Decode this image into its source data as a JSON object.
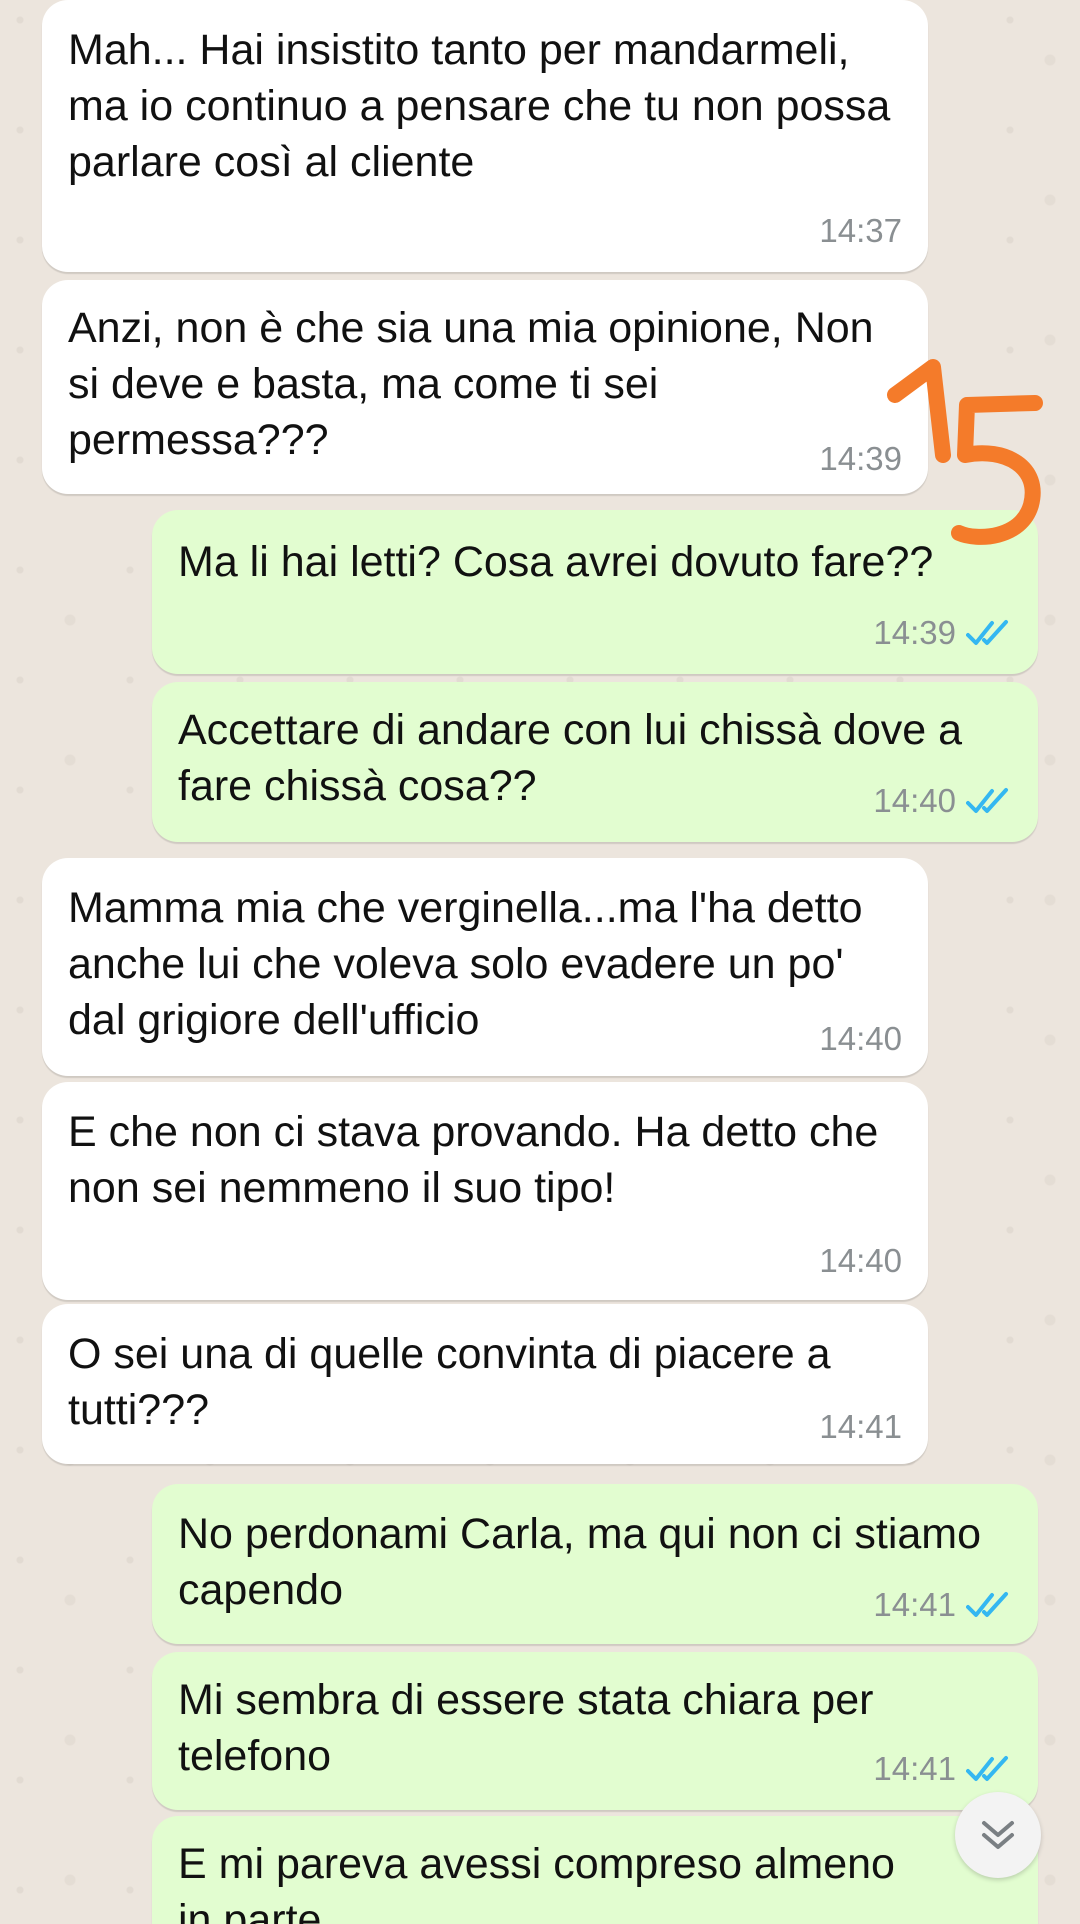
{
  "messages": [
    {
      "dir": "in",
      "text": "Mah... Hai insistito tanto per mandarmeli, ma io continuo a pensare che tu non possa parlare così al cliente",
      "time": "14:37"
    },
    {
      "dir": "in",
      "text": "Anzi, non è che sia una mia opinione, Non si deve e basta, ma come ti sei permessa???",
      "time": "14:39"
    },
    {
      "dir": "out",
      "text": "Ma li hai letti? Cosa avrei dovuto fare??",
      "time": "14:39",
      "status": "read"
    },
    {
      "dir": "out",
      "text": "Accettare di andare con lui chissà dove a fare chissà cosa??",
      "time": "14:40",
      "status": "read"
    },
    {
      "dir": "in",
      "text": "Mamma mia che verginella...ma l'ha detto anche lui che voleva solo evadere un po' dal grigiore dell'ufficio",
      "time": "14:40"
    },
    {
      "dir": "in",
      "text": "E che non ci stava provando. Ha detto che non sei nemmeno il suo tipo!",
      "time": "14:40"
    },
    {
      "dir": "in",
      "text": "O sei una di quelle convinta di piacere a tutti???",
      "time": "14:41"
    },
    {
      "dir": "out",
      "text": "No perdonami Carla, ma qui non ci stiamo capendo",
      "time": "14:41",
      "status": "read"
    },
    {
      "dir": "out",
      "text": "Mi sembra di essere stata chiara per telefono",
      "time": "14:41",
      "status": "read"
    },
    {
      "dir": "out",
      "text": "E mi pareva avessi compreso almeno in parte",
      "time": "",
      "status": ""
    }
  ],
  "annotation": {
    "text": "15",
    "color": "#f47b2a"
  },
  "colors": {
    "incoming": "#ffffff",
    "outgoing": "#e2fdd0",
    "read_ticks": "#34b7f1",
    "background": "#ece5dd"
  },
  "scroll_button": {
    "icon": "double-chevron-down-icon"
  }
}
